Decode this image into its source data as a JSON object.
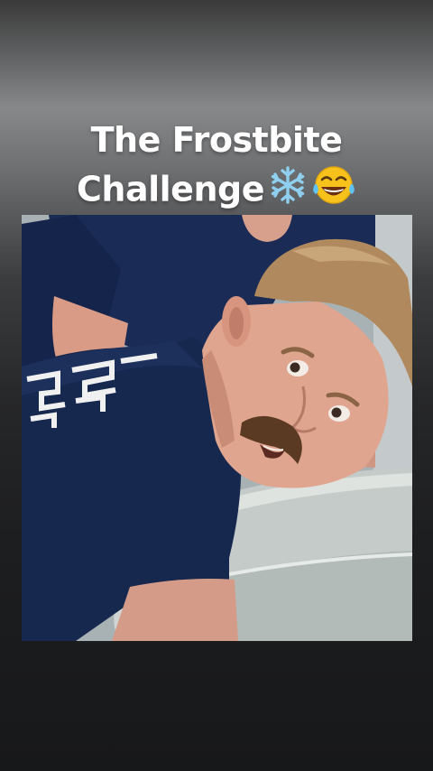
{
  "post": {
    "caption_line1": "The Frostbite",
    "caption_line2": "Challenge",
    "caption_emojis": [
      "snowflake-emoji",
      "laughing-tears-emoji"
    ]
  },
  "photo": {
    "description_label": "video-frame",
    "colors": {
      "shirt": "#17284f",
      "skin": "#e1a58f",
      "hair": "#b08a5e",
      "tub": "#bfc5c2",
      "background": "#a7b0b3"
    }
  }
}
